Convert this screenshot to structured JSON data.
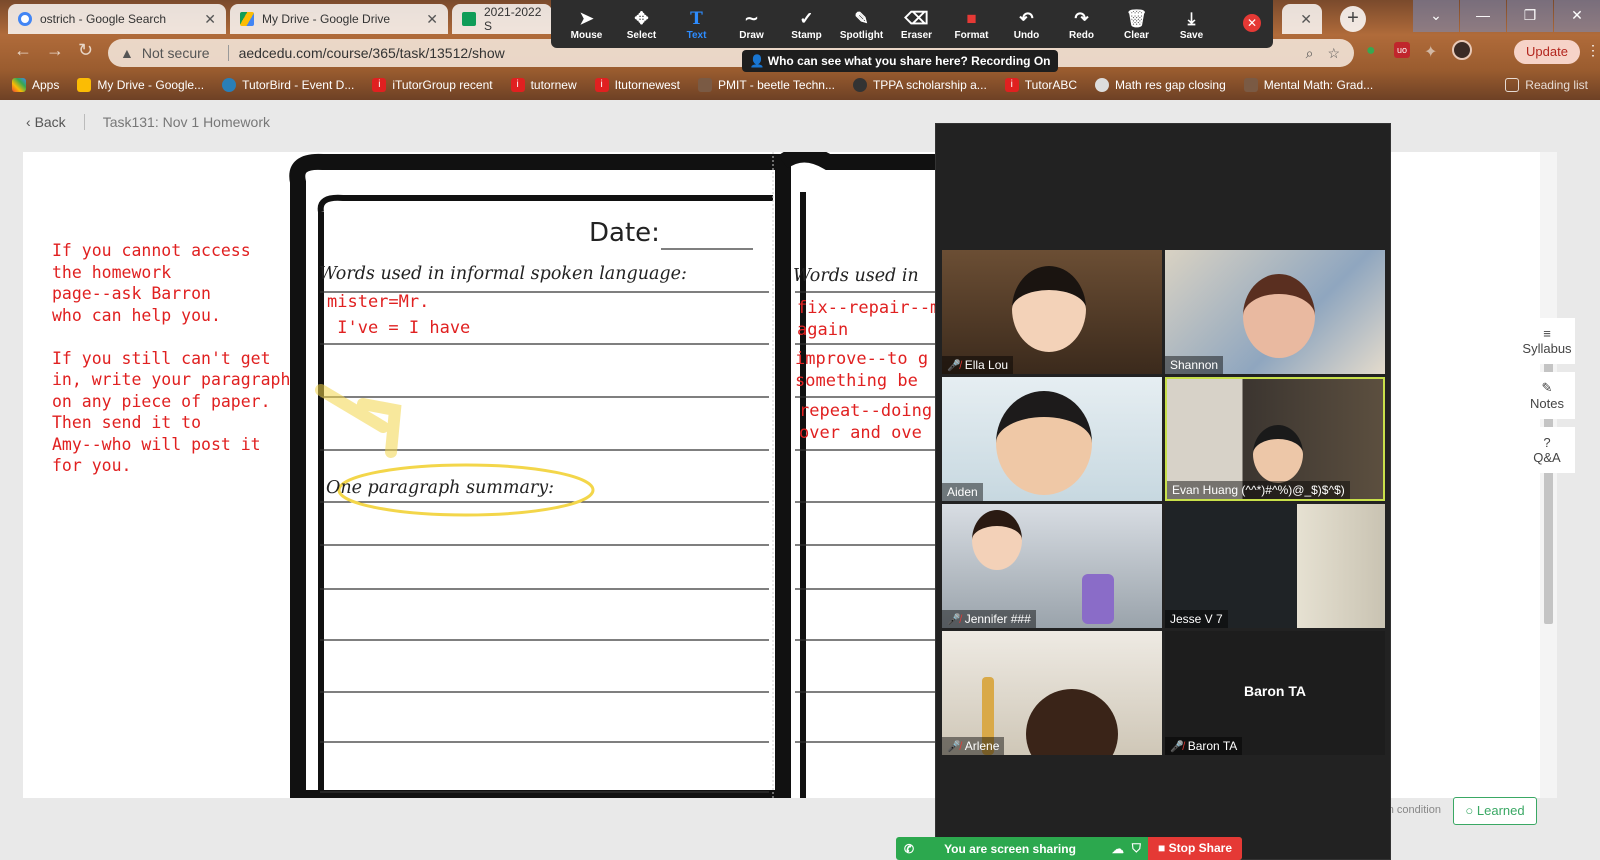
{
  "browser": {
    "tabs": [
      {
        "title": "ostrich - Google Search",
        "icon": "google-icon",
        "color": "#4285f4"
      },
      {
        "title": "My Drive - Google Drive",
        "icon": "google-drive-icon",
        "color": "#fbbc04"
      },
      {
        "title": "2021-2022 S",
        "icon": "google-sheets-icon",
        "color": "#0f9d58"
      }
    ],
    "new_tab": "+",
    "address": {
      "security": "Not secure",
      "url": "aedcedu.com/course/365/task/13512/show"
    },
    "update_label": "Update",
    "bookmarks": [
      {
        "label": "Apps",
        "icon": "apps-grid-icon"
      },
      {
        "label": "My Drive - Google...",
        "icon": "google-drive-icon"
      },
      {
        "label": "TutorBird - Event D...",
        "icon": "tutorbird-icon"
      },
      {
        "label": "iTutorGroup recent",
        "icon": "itutor-icon"
      },
      {
        "label": "tutornew",
        "icon": "itutor-icon"
      },
      {
        "label": "Itutornewest",
        "icon": "itutor-icon"
      },
      {
        "label": "PMIT - beetle Techn...",
        "icon": "page-icon"
      },
      {
        "label": "TPPA scholarship a...",
        "icon": "tppa-icon"
      },
      {
        "label": "TutorABC",
        "icon": "itutor-icon"
      },
      {
        "label": "Math res gap closing",
        "icon": "globe-icon"
      },
      {
        "label": "Mental Math: Grad...",
        "icon": "page-icon"
      },
      {
        "label": "Reading list",
        "icon": "reading-list-icon"
      }
    ]
  },
  "annotate_toolbar": {
    "tools": [
      {
        "label": "Mouse",
        "glyph": "➤"
      },
      {
        "label": "Select",
        "glyph": "✥"
      },
      {
        "label": "Text",
        "glyph": "T"
      },
      {
        "label": "Draw",
        "glyph": "∼"
      },
      {
        "label": "Stamp",
        "glyph": "✓"
      },
      {
        "label": "Spotlight",
        "glyph": "✎"
      },
      {
        "label": "Eraser",
        "glyph": "⌫"
      },
      {
        "label": "Format",
        "glyph": "■"
      },
      {
        "label": "Undo",
        "glyph": "↶"
      },
      {
        "label": "Redo",
        "glyph": "↷"
      },
      {
        "label": "Clear",
        "glyph": "🗑"
      },
      {
        "label": "Save",
        "glyph": "⤓"
      }
    ],
    "active_tool": "Text",
    "recording_notice": "Who can see what you share here? Recording On"
  },
  "page": {
    "back_label": "Back",
    "task_title": "Task131:  Nov 1 Homework",
    "right_nav": [
      {
        "label": "Syllabus",
        "icon": "list-icon"
      },
      {
        "label": "Notes",
        "icon": "pencil-icon"
      },
      {
        "label": "Q&A",
        "icon": "question-icon"
      }
    ],
    "completion_condition": "etion condition",
    "learned_label": "Learned"
  },
  "worksheet": {
    "instructions": "If you cannot access\nthe homework\npage--ask Barron\nwho can help you.\n\nIf you still can't get\nin, write your paragraph\non any piece of paper.\nThen send it to\nAmy--who will post it\nfor you.",
    "date_label": "Date:",
    "left_heading": "Words used in informal spoken language:",
    "right_heading": "Words used in",
    "left_entries": [
      "mister=Mr.",
      " I've = I have"
    ],
    "right_entries": [
      "fix--repair--m\nagain",
      "improve--to g\nsomething be",
      "repeat--doing\nover and ove"
    ],
    "summary_label": "One paragraph summary:"
  },
  "participants": [
    {
      "name": "Ella Lou",
      "muted": true
    },
    {
      "name": "Shannon",
      "muted": false
    },
    {
      "name": "Aiden",
      "muted": false
    },
    {
      "name": "Evan Huang (^^*)#^%)@_$)$^$)",
      "muted": false,
      "speaking": true
    },
    {
      "name": "Jennifer ###",
      "muted": true
    },
    {
      "name": "Jesse V 7",
      "muted": false
    },
    {
      "name": "Arlene",
      "muted": true
    },
    {
      "name": "Baron TA",
      "muted": true,
      "video_off": true
    }
  ],
  "share_bar": {
    "status": "You are screen sharing",
    "stop_label": "Stop Share"
  }
}
